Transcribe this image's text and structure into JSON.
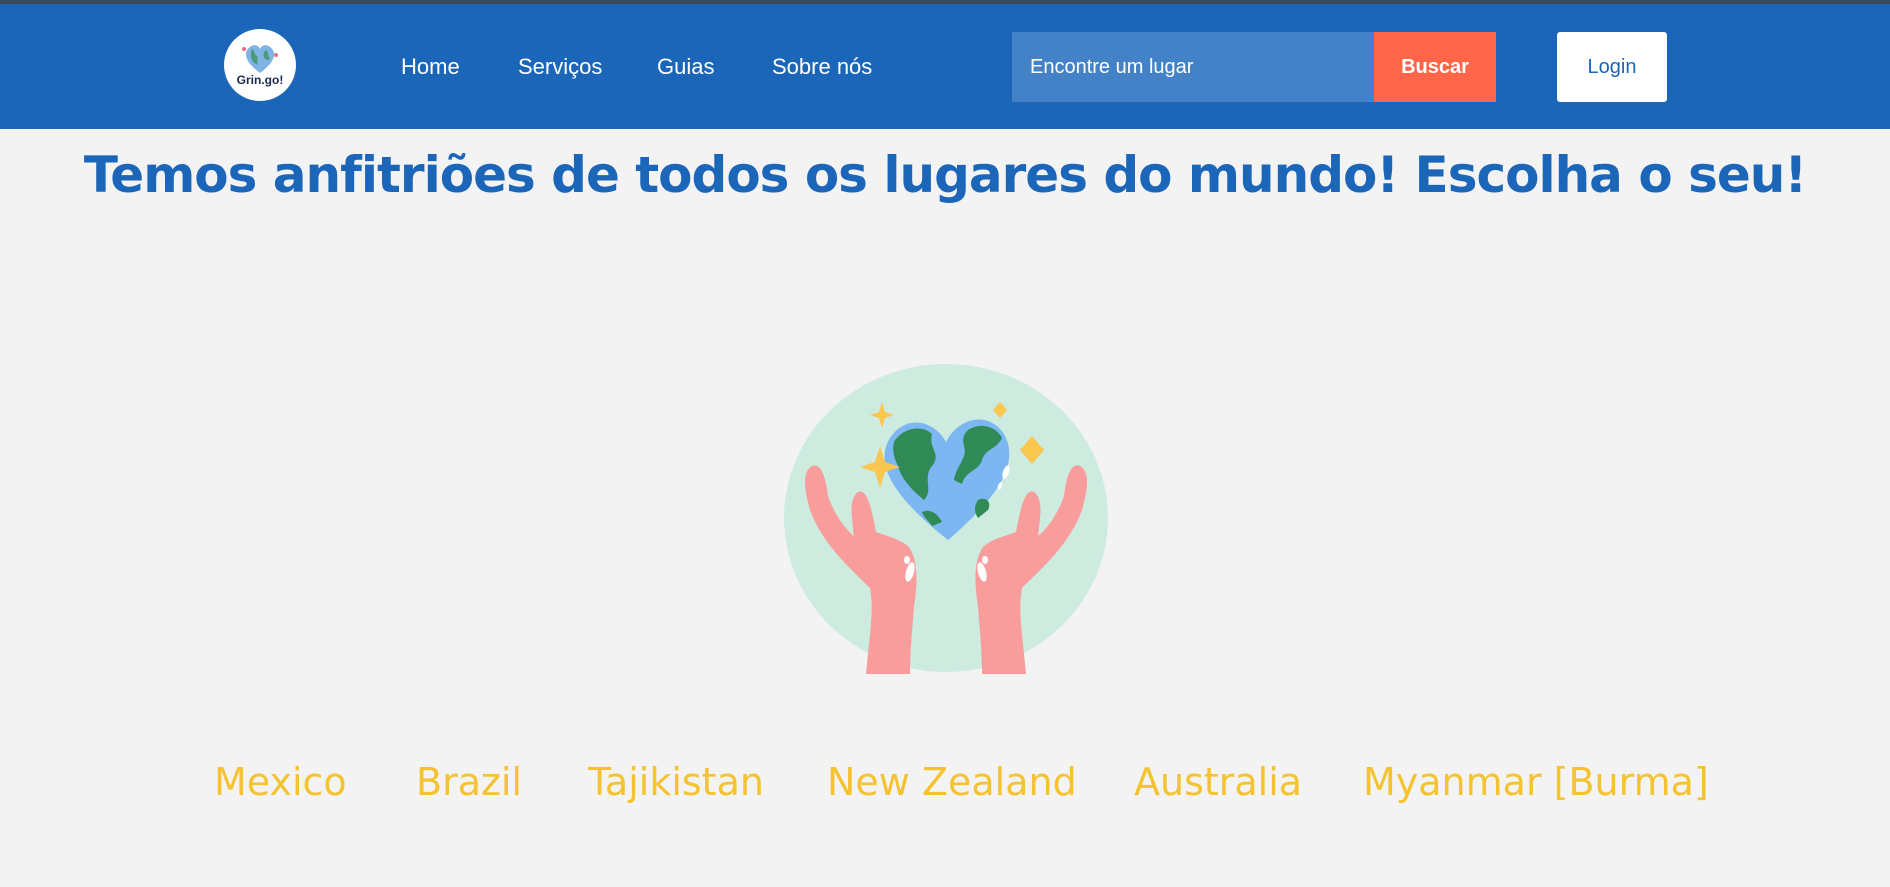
{
  "header": {
    "logo_text": "Grin.go!",
    "nav": [
      "Home",
      "Serviços",
      "Guias",
      "Sobre nós"
    ],
    "search": {
      "placeholder": "Encontre um lugar",
      "button_label": "Buscar"
    },
    "login_label": "Login"
  },
  "main": {
    "headline": "Temos anfitriões de todos os lugares do mundo! Escolha o seu!",
    "illustration": "hands-holding-heart-globe",
    "countries": [
      "Mexico",
      "Brazil",
      "Tajikistan",
      "New Zealand",
      "Australia",
      "Myanmar [Burma]"
    ]
  },
  "colors": {
    "header_bg": "#1b66b9",
    "search_bg": "#4382c6",
    "search_button": "#ff6549",
    "headline": "#1b66b9",
    "country_link": "#f5c230",
    "page_bg": "#f3f3f3"
  }
}
